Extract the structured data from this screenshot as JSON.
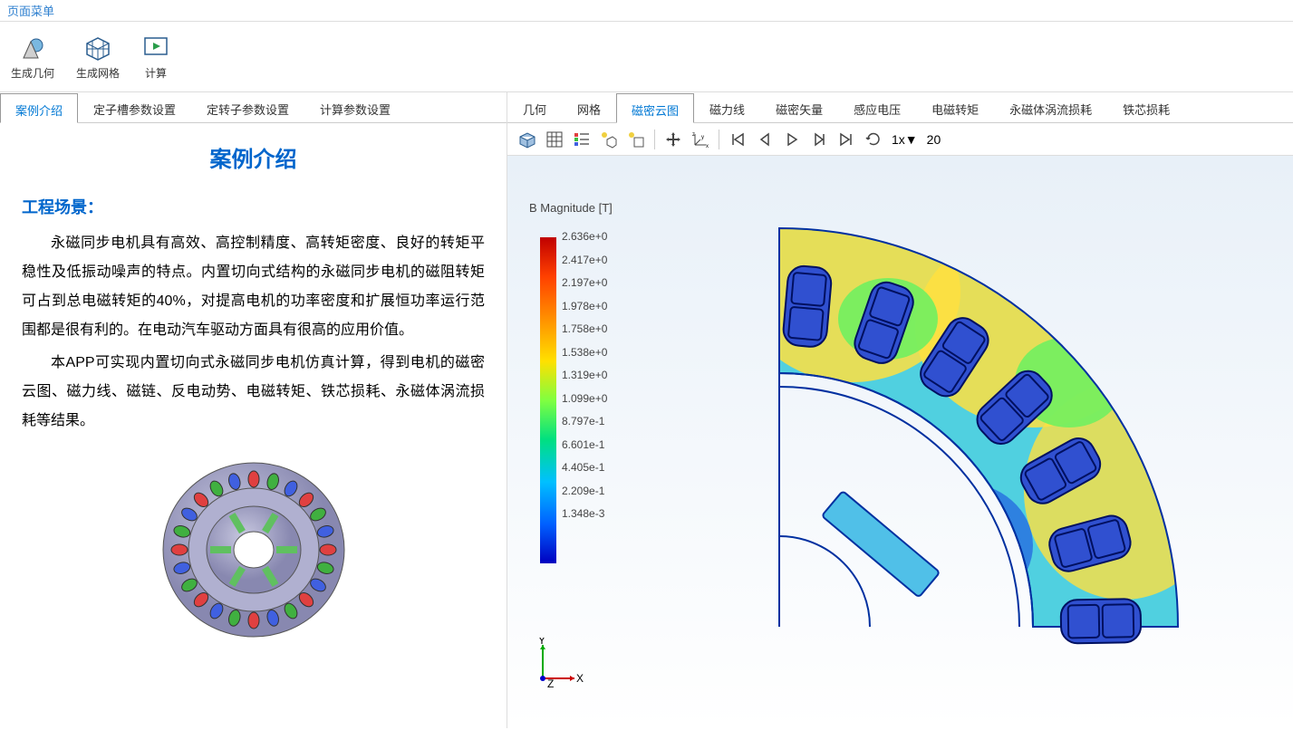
{
  "menu": {
    "page_menu": "页面菜单"
  },
  "ribbon": {
    "gen_geometry": "生成几何",
    "gen_mesh": "生成网格",
    "compute": "计算"
  },
  "left_tabs": {
    "intro": "案例介绍",
    "stator_slot": "定子槽参数设置",
    "rotor_stator": "定转子参数设置",
    "calc_params": "计算参数设置",
    "active": 0
  },
  "intro": {
    "title": "案例介绍",
    "section": "工程场景：",
    "p1": "永磁同步电机具有高效、高控制精度、高转矩密度、良好的转矩平稳性及低振动噪声的特点。内置切向式结构的永磁同步电机的磁阻转矩可占到总电磁转矩的40%，对提高电机的功率密度和扩展恒功率运行范围都是很有利的。在电动汽车驱动方面具有很高的应用价值。",
    "p2": "本APP可实现内置切向式永磁同步电机仿真计算，得到电机的磁密云图、磁力线、磁链、反电动势、电磁转矩、铁芯损耗、永磁体涡流损耗等结果。"
  },
  "right_tabs": {
    "geometry": "几何",
    "mesh": "网格",
    "flux_density": "磁密云图",
    "flux_lines": "磁力线",
    "flux_vector": "磁密矢量",
    "voltage": "感应电压",
    "torque": "电磁转矩",
    "pm_eddy_loss": "永磁体涡流损耗",
    "core_loss": "铁芯损耗",
    "active": 2
  },
  "playback": {
    "speed": "1x",
    "frame": "20"
  },
  "legend": {
    "title": "B Magnitude [T]",
    "values": [
      "2.636e+0",
      "2.417e+0",
      "2.197e+0",
      "1.978e+0",
      "1.758e+0",
      "1.538e+0",
      "1.319e+0",
      "1.099e+0",
      "8.797e-1",
      "6.601e-1",
      "4.405e-1",
      "2.209e-1",
      "1.348e-3"
    ]
  },
  "axes": {
    "x": "X",
    "y": "Y",
    "z": "Z"
  }
}
